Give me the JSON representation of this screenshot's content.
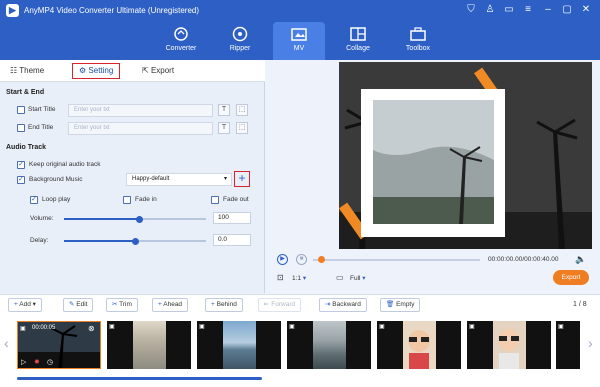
{
  "window": {
    "title": "AnyMP4 Video Converter Ultimate (Unregistered)"
  },
  "nav": {
    "tabs": [
      {
        "label": "Converter",
        "icon": "converter-icon"
      },
      {
        "label": "Ripper",
        "icon": "ripper-icon"
      },
      {
        "label": "MV",
        "icon": "mv-icon"
      },
      {
        "label": "Collage",
        "icon": "collage-icon"
      },
      {
        "label": "Toolbox",
        "icon": "toolbox-icon"
      }
    ],
    "active": "MV"
  },
  "subtabs": {
    "theme": "Theme",
    "setting": "Setting",
    "export": "Export"
  },
  "start_end": {
    "heading": "Start & End",
    "start_title": {
      "label": "Start Title",
      "placeholder": "Enter your txt",
      "checked": false
    },
    "end_title": {
      "label": "End Title",
      "placeholder": "Enter your txt",
      "checked": false
    }
  },
  "audio": {
    "heading": "Audio Track",
    "keep_original": {
      "label": "Keep original audio track",
      "checked": true
    },
    "background_music": {
      "label": "Background Music",
      "checked": true,
      "selected": "Happy-default"
    },
    "loop_play": {
      "label": "Loop play",
      "checked": true
    },
    "fade_in": {
      "label": "Fade in",
      "checked": false
    },
    "fade_out": {
      "label": "Fade out",
      "checked": false
    },
    "volume": {
      "label": "Volume:",
      "value": "100",
      "level": 0.53
    },
    "delay": {
      "label": "Delay:",
      "value": "0.0",
      "level": 0.5
    }
  },
  "player": {
    "time": "00:00:00.00/00:00:40.00",
    "ratio": "1:1",
    "view": "Full",
    "export_label": "Export"
  },
  "toolbar": {
    "add": "Add",
    "edit": "Edit",
    "trim": "Trim",
    "ahead": "Ahead",
    "behind": "Behind",
    "forward": "Forward",
    "backward": "Backward",
    "empty": "Empty",
    "page": "1 / 8"
  },
  "clips": [
    {
      "time": "00:00:05"
    },
    {},
    {},
    {},
    {},
    {}
  ],
  "colors": {
    "brand": "#2d5fc5",
    "accent": "#ef7d22",
    "highlight": "#d9242b"
  }
}
